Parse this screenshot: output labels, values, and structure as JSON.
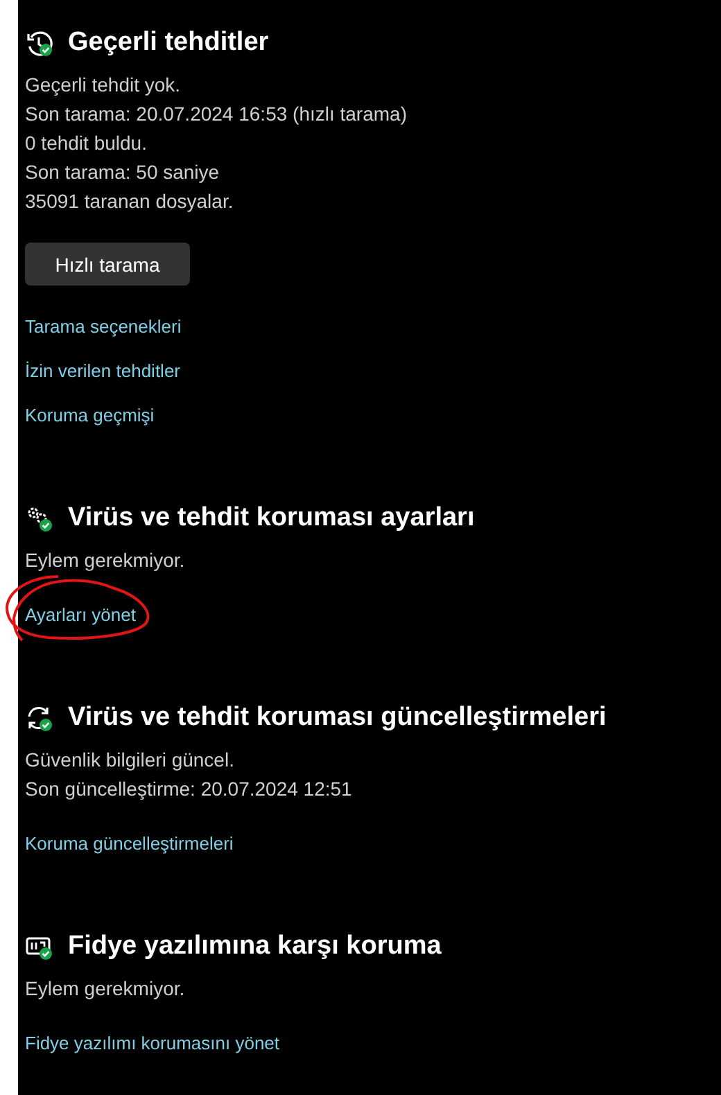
{
  "sections": [
    {
      "kind": "history",
      "title": "Geçerli tehditler",
      "lines": [
        "Geçerli tehdit yok.",
        "Son tarama: 20.07.2024 16:53 (hızlı tarama)",
        "0 tehdit buldu.",
        "Son tarama: 50 saniye",
        "35091 taranan dosyalar."
      ],
      "button": "Hızlı tarama",
      "links": [
        {
          "label": "Tarama seçenekleri",
          "circled": false
        },
        {
          "label": "İzin verilen tehditler",
          "circled": false
        },
        {
          "label": "Koruma geçmişi",
          "circled": false
        }
      ]
    },
    {
      "kind": "gears",
      "title": "Virüs ve tehdit koruması ayarları",
      "lines": [
        "Eylem gerekmiyor."
      ],
      "links": [
        {
          "label": "Ayarları yönet",
          "circled": true
        }
      ]
    },
    {
      "kind": "sync",
      "title": "Virüs ve tehdit koruması güncelleştirmeleri",
      "lines": [
        "Güvenlik bilgileri güncel.",
        "Son güncelleştirme: 20.07.2024 12:51"
      ],
      "links": [
        {
          "label": "Koruma güncelleştirmeleri",
          "circled": false
        }
      ]
    },
    {
      "kind": "ransomware",
      "title": "Fidye yazılımına karşı koruma",
      "lines": [
        "Eylem gerekmiyor."
      ],
      "links": [
        {
          "label": "Fidye yazılımı korumasını yönet",
          "circled": false
        }
      ]
    }
  ]
}
